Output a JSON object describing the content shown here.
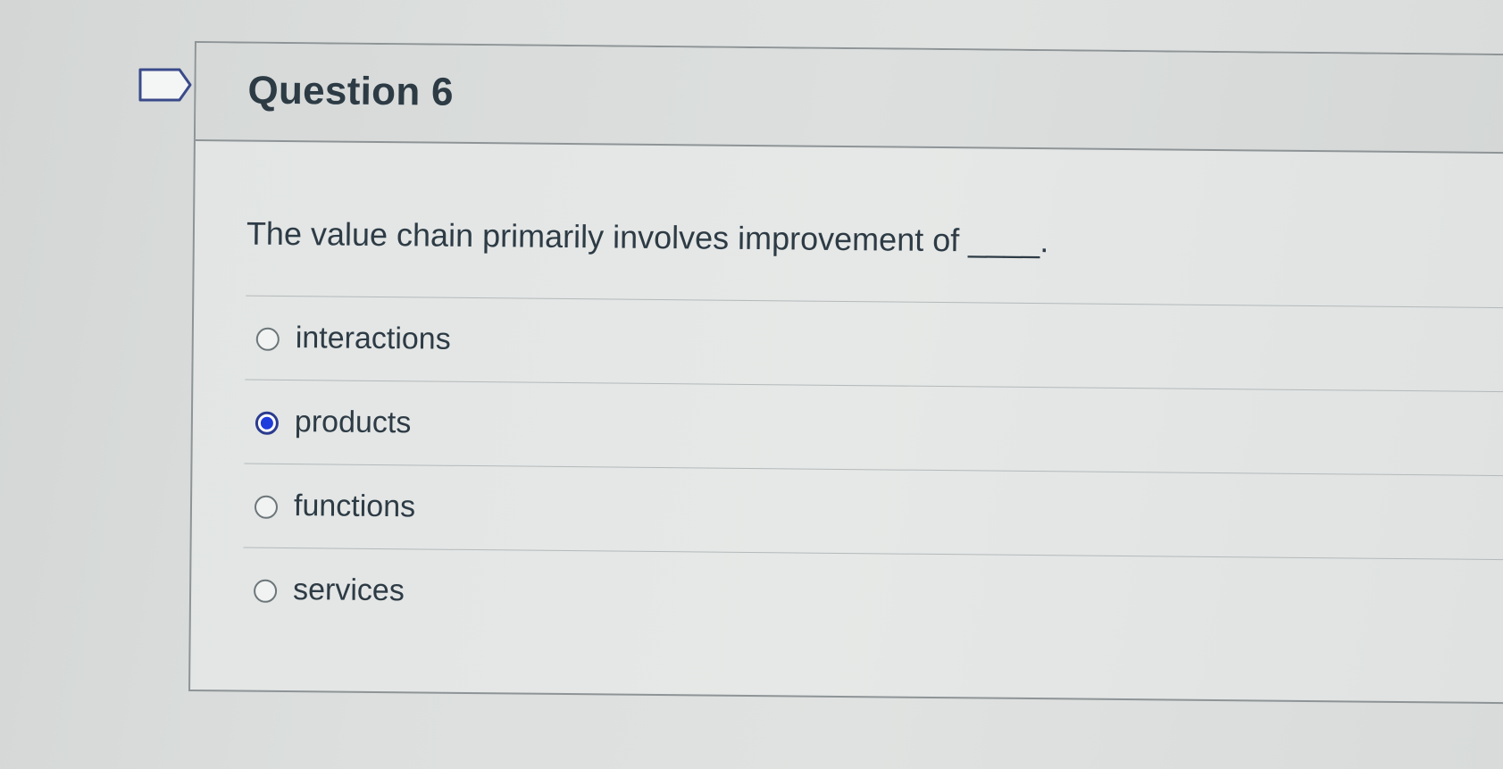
{
  "question": {
    "title": "Question 6",
    "text": "The value chain primarily involves improvement of ____."
  },
  "answers": [
    {
      "label": "interactions",
      "selected": false
    },
    {
      "label": "products",
      "selected": true
    },
    {
      "label": "functions",
      "selected": false
    },
    {
      "label": "services",
      "selected": false
    }
  ],
  "icons": {
    "flag": "flag-question-icon"
  },
  "colors": {
    "selected_radio": "#1e3bdc",
    "text": "#2d3b45"
  }
}
